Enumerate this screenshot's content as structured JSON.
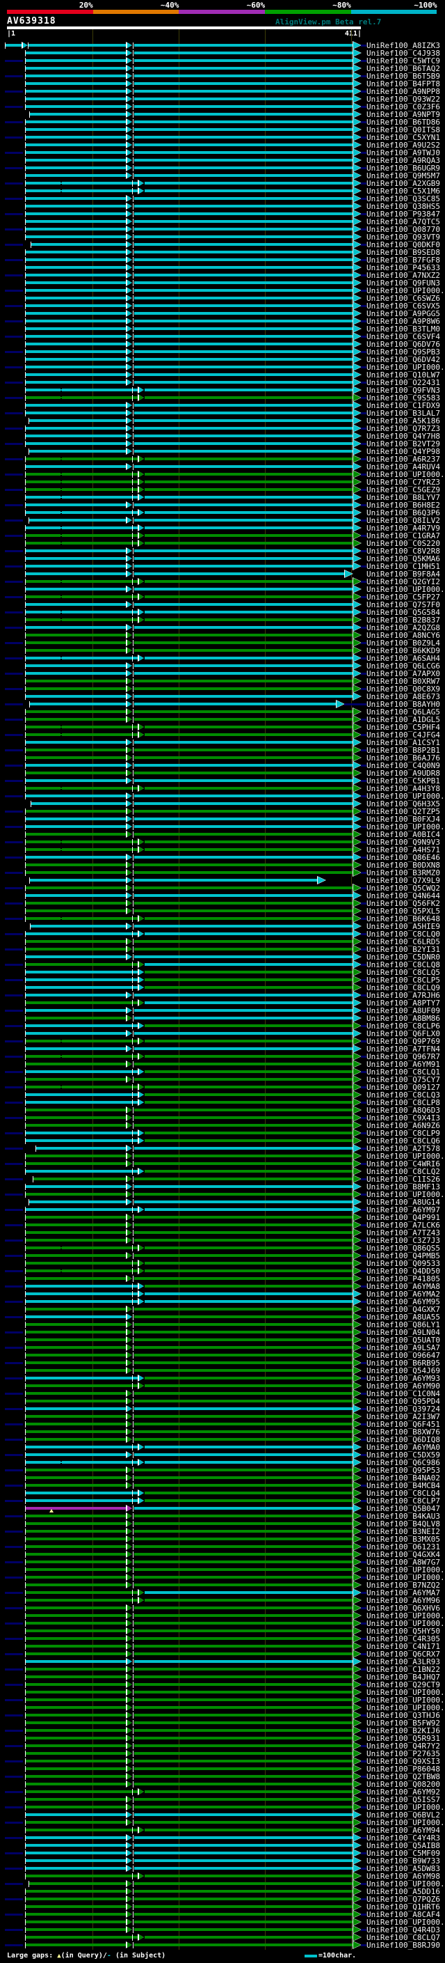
{
  "header": {
    "query_id": "AV639318",
    "app_title": "AlignView.pm Beta rel.7",
    "ruler_left": "|1",
    "ruler_right": "411|",
    "scale": [
      {
        "label": "20%",
        "color": "#e4001c"
      },
      {
        "label": "~40%",
        "color": "#e07800"
      },
      {
        "label": "~60%",
        "color": "#a02cb4"
      },
      {
        "label": "~80%",
        "color": "#00a000"
      },
      {
        "label": "~100%",
        "color": "#00b4c8"
      }
    ]
  },
  "legend": {
    "gaps_label": "Large gaps: ",
    "query_symbol": "▲",
    "in_query": "(in Query)/",
    "subject_symbol": "-",
    "in_subject": " (in Subject)",
    "scale_label": "=100char."
  },
  "colors": {
    "c": "#00c2cc",
    "g": "#008c00",
    "m": "#a428b0",
    "navy": "#000066",
    "grid": "#3c3c08",
    "yellow": "#ffff99",
    "label": "#f0f0f0",
    "black": "#000000",
    "white": "#ffffff"
  },
  "label_prefix": "UniRef100_",
  "rows": [
    {
      "l": "A8IZK3",
      "pre": 1,
      "s": 41
    },
    {
      "l": "C4J938"
    },
    {
      "l": "C5WTC9"
    },
    {
      "l": "B6TAQ2"
    },
    {
      "l": "B6T5B9"
    },
    {
      "l": "B4FPT8"
    },
    {
      "l": "A9NPP8"
    },
    {
      "l": "Q93W22"
    },
    {
      "l": "C0Z3F6"
    },
    {
      "l": "A9NPT9",
      "s": 43
    },
    {
      "l": "B6TD86"
    },
    {
      "l": "Q0ITS8"
    },
    {
      "l": "C5XYN1"
    },
    {
      "l": "A9U2S2"
    },
    {
      "l": "A9TWJ0"
    },
    {
      "l": "A9RQA3"
    },
    {
      "l": "B6UGR9"
    },
    {
      "l": "Q9M5M7"
    },
    {
      "l": "A2XGB9",
      "g": "l",
      "d": 1
    },
    {
      "l": "C5X1M6",
      "g": "l",
      "d": 1
    },
    {
      "l": "Q3SC85"
    },
    {
      "l": "Q38HS5"
    },
    {
      "l": "P93847"
    },
    {
      "l": "A7QTC5"
    },
    {
      "l": "Q08770"
    },
    {
      "l": "Q93VT9"
    },
    {
      "l": "Q0DKF0",
      "s": 45
    },
    {
      "l": "B9SED8"
    },
    {
      "l": "B7FGF8"
    },
    {
      "l": "P45633"
    },
    {
      "l": "A7NXZ2"
    },
    {
      "l": "Q9FUN3"
    },
    {
      "l": "UPI000.."
    },
    {
      "l": "C6SWZ6"
    },
    {
      "l": "C6SVX5"
    },
    {
      "l": "A9PGG5"
    },
    {
      "l": "A9P8W6"
    },
    {
      "l": "B3TLM0"
    },
    {
      "l": "C6SVF4"
    },
    {
      "l": "Q6DV76"
    },
    {
      "l": "Q9SPB3"
    },
    {
      "l": "Q6DV42"
    },
    {
      "l": "UPI000.."
    },
    {
      "l": "Q10LW7"
    },
    {
      "l": "O22431"
    },
    {
      "l": "Q9FVN3",
      "g": "l",
      "d": 1
    },
    {
      "l": "C9S583",
      "h": "g",
      "g": "l",
      "d": 1
    },
    {
      "l": "C1FDX9"
    },
    {
      "l": "B3LAL7"
    },
    {
      "l": "A5K186",
      "s": 42
    },
    {
      "l": "Q7R7Z3"
    },
    {
      "l": "Q4Y7H8"
    },
    {
      "l": "B2VT29"
    },
    {
      "l": "Q4YP98",
      "s": 42
    },
    {
      "l": "A6R237",
      "h": "g",
      "g": "l",
      "d": 1
    },
    {
      "l": "A4RUV4"
    },
    {
      "l": "UPI000..",
      "h": "g",
      "g": "l",
      "d": 1
    },
    {
      "l": "C7YRZ3",
      "h": "g",
      "g": "l",
      "d": 1
    },
    {
      "l": "C5GEZ9",
      "h": "g",
      "g": "l",
      "d": 1
    },
    {
      "l": "B8LYV7",
      "g": "l",
      "d": 1
    },
    {
      "l": "B6H8E2"
    },
    {
      "l": "B6Q3P6",
      "g": "l",
      "d": 1
    },
    {
      "l": "Q8ILV2",
      "s": 42
    },
    {
      "l": "A4R7V9",
      "g": "l",
      "d": 1
    },
    {
      "l": "C1GRA7",
      "h": "g",
      "g": "l",
      "d": 1
    },
    {
      "l": "C0S220",
      "h": "g",
      "g": "l",
      "d": 1
    },
    {
      "l": "C8V2R8"
    },
    {
      "l": "Q5KMA6"
    },
    {
      "l": "C1MH51"
    },
    {
      "l": "B9F8A4",
      "e": 496
    },
    {
      "l": "Q2GYI2",
      "h": "g",
      "g": "l",
      "d": 1
    },
    {
      "l": "UPI000.."
    },
    {
      "l": "C5FP27",
      "h": "g",
      "g": "l",
      "d": 1
    },
    {
      "l": "Q7S7F0"
    },
    {
      "l": "Q5G584",
      "g": "l",
      "d": 1
    },
    {
      "l": "B2B837",
      "h": "g",
      "g": "l",
      "d": 1
    },
    {
      "l": "A2QZG8"
    },
    {
      "l": "A8NCY6",
      "h": "g"
    },
    {
      "l": "B0Z9L4",
      "h": "g"
    },
    {
      "l": "B6KKD9",
      "h": "g"
    },
    {
      "l": "A6SAH4",
      "g": "l",
      "d": 1
    },
    {
      "l": "Q6LCG6"
    },
    {
      "l": "A7APX0"
    },
    {
      "l": "B0XRW7",
      "h": "g"
    },
    {
      "l": "Q0C8X9",
      "h": "g"
    },
    {
      "l": "A8E673"
    },
    {
      "l": "B8AYH0",
      "s": 43,
      "e": 484
    },
    {
      "l": "Q6LAG5",
      "h": "g"
    },
    {
      "l": "A1DGL5",
      "h": "g"
    },
    {
      "l": "C5PHF4",
      "h": "g",
      "g": "l",
      "d": 1
    },
    {
      "l": "C4JFG4",
      "h": "g",
      "g": "l",
      "d": 1
    },
    {
      "l": "A1CSY1"
    },
    {
      "l": "B8P2B1",
      "h": "g"
    },
    {
      "l": "B6AJ76",
      "h": "g"
    },
    {
      "l": "C4Q0N9"
    },
    {
      "l": "A9UDR8",
      "h": "g"
    },
    {
      "l": "C5KPB1"
    },
    {
      "l": "A4H3Y8",
      "h": "g",
      "g": "l",
      "d": 1
    },
    {
      "l": "UPI000.."
    },
    {
      "l": "Q6H3X5",
      "s": 45
    },
    {
      "l": "Q2TZP5",
      "h": "g"
    },
    {
      "l": "B0FXJ4"
    },
    {
      "l": "UPI000.."
    },
    {
      "l": "A0BIC4",
      "h": "g"
    },
    {
      "l": "Q9N9V3",
      "h": "g",
      "g": "l",
      "d": 1
    },
    {
      "l": "A4HS71",
      "h": "g",
      "g": "l",
      "d": 1
    },
    {
      "l": "Q86E46"
    },
    {
      "l": "B0DXN8",
      "h": "g"
    },
    {
      "l": "B3RMZ0",
      "h": "g"
    },
    {
      "l": "Q7X9L9",
      "s": 43,
      "e": 457
    },
    {
      "l": "Q5CWQ2",
      "h": "g"
    },
    {
      "l": "Q4N644"
    },
    {
      "l": "Q56FK2",
      "h": "g"
    },
    {
      "l": "Q5PXL5",
      "h": "g"
    },
    {
      "l": "B6K648",
      "h": "g",
      "g": "l",
      "d": 1
    },
    {
      "l": "A5HIE9",
      "s": 44
    },
    {
      "l": "C8CLQ0",
      "g": "l"
    },
    {
      "l": "C6LRD5",
      "h": "g"
    },
    {
      "l": "B2YI31",
      "h": "g"
    },
    {
      "l": "C5DNR0"
    },
    {
      "l": "C8CLQ8",
      "h": "g",
      "t": "c",
      "g": "l"
    },
    {
      "l": "C8CLQ5",
      "t": "g",
      "g": "l"
    },
    {
      "l": "C8CLP5",
      "t": "g",
      "g": "l"
    },
    {
      "l": "C8CLQ9",
      "t": "g",
      "g": "l"
    },
    {
      "l": "A7RJH6"
    },
    {
      "l": "A8PTY7",
      "h": "g",
      "t": "c",
      "g": "l"
    },
    {
      "l": "A8UF09"
    },
    {
      "l": "A8BM86",
      "h": "g",
      "t": "c"
    },
    {
      "l": "C8CLP6",
      "t": "g",
      "g": "l"
    },
    {
      "l": "Q6FLX0"
    },
    {
      "l": "Q9P769",
      "h": "g",
      "g": "l",
      "d": 1
    },
    {
      "l": "A7TFN4"
    },
    {
      "l": "Q967R7",
      "h": "g",
      "g": "l",
      "d": 1
    },
    {
      "l": "A6YM91",
      "h": "g"
    },
    {
      "l": "C8CLQ1",
      "t": "g",
      "g": "l"
    },
    {
      "l": "Q75CY7",
      "h": "g"
    },
    {
      "l": "Q09127",
      "h": "g",
      "g": "l",
      "d": 1
    },
    {
      "l": "C8CLQ3",
      "t": "g",
      "g": "l"
    },
    {
      "l": "C8CLP8",
      "t": "g",
      "g": "l"
    },
    {
      "l": "A8Q6D3",
      "h": "g"
    },
    {
      "l": "C9X4I3",
      "h": "g"
    },
    {
      "l": "A6N9Z6",
      "h": "g"
    },
    {
      "l": "C8CLP9",
      "t": "g",
      "g": "l"
    },
    {
      "l": "C8CLQ6",
      "t": "g",
      "g": "l"
    },
    {
      "l": "A2T578",
      "s": 52
    },
    {
      "l": "UPI000..",
      "h": "g"
    },
    {
      "l": "C4WRI6",
      "h": "g"
    },
    {
      "l": "C8CLQ2",
      "t": "g",
      "g": "l"
    },
    {
      "l": "C1IS26",
      "h": "g",
      "s": 48
    },
    {
      "l": "B8MF13"
    },
    {
      "l": "UPI000..",
      "h": "g"
    },
    {
      "l": "A8UG14",
      "s": 42
    },
    {
      "l": "A6YM97",
      "g": "l"
    },
    {
      "l": "Q4P991",
      "h": "g"
    },
    {
      "l": "A7LCK6",
      "h": "g"
    },
    {
      "l": "A7TZ43",
      "h": "g"
    },
    {
      "l": "C3Z7J3",
      "h": "g"
    },
    {
      "l": "Q86QS5",
      "h": "g",
      "g": "l",
      "d": 1
    },
    {
      "l": "Q4PMB5",
      "h": "g"
    },
    {
      "l": "Q09533",
      "h": "g",
      "t": "g",
      "g": "l"
    },
    {
      "l": "Q4DD50",
      "h": "g",
      "g": "l",
      "d": 1
    },
    {
      "l": "P41805",
      "h": "g"
    },
    {
      "l": "A6YMA8",
      "t": "g",
      "g": "l"
    },
    {
      "l": "A6YMA2",
      "g": "l"
    },
    {
      "l": "A6YM95",
      "g": "l"
    },
    {
      "l": "Q4GXK7",
      "h": "g"
    },
    {
      "l": "A8UA55",
      "t": "g"
    },
    {
      "l": "Q86LY1",
      "h": "g"
    },
    {
      "l": "A9LN04",
      "h": "g"
    },
    {
      "l": "Q5UAT0",
      "h": "g"
    },
    {
      "l": "A9LSA7",
      "h": "g"
    },
    {
      "l": "O96647",
      "h": "g"
    },
    {
      "l": "B6RB95",
      "h": "g"
    },
    {
      "l": "Q54J69",
      "h": "g"
    },
    {
      "l": "A6YM93",
      "t": "g",
      "g": "l"
    },
    {
      "l": "A6YM90",
      "h": "g",
      "t": "g",
      "g": "l"
    },
    {
      "l": "C1C0N4",
      "h": "g"
    },
    {
      "l": "Q95PD4",
      "h": "g"
    },
    {
      "l": "Q39724"
    },
    {
      "l": "A2I3W7",
      "h": "g"
    },
    {
      "l": "Q6F451",
      "h": "g"
    },
    {
      "l": "B8XW76",
      "h": "g"
    },
    {
      "l": "Q6DIQ8",
      "h": "g"
    },
    {
      "l": "A6YMA0",
      "g": "l"
    },
    {
      "l": "C5DX59"
    },
    {
      "l": "Q6C986",
      "g": "l",
      "d": 1
    },
    {
      "l": "Q95P53",
      "h": "g"
    },
    {
      "l": "B4NA02",
      "h": "g"
    },
    {
      "l": "B4MCB4",
      "h": "g"
    },
    {
      "l": "C8CLQ4",
      "t": "g",
      "g": "l"
    },
    {
      "l": "C8CLP7",
      "t": "g",
      "g": "l"
    },
    {
      "l": "Q5B047",
      "h": "m",
      "t": "c",
      "gm": 1
    },
    {
      "l": "B4KAU3",
      "h": "g"
    },
    {
      "l": "B4QLV8",
      "h": "g"
    },
    {
      "l": "B3NEI2",
      "h": "g"
    },
    {
      "l": "B3MX05",
      "h": "g"
    },
    {
      "l": "O61231",
      "h": "g"
    },
    {
      "l": "Q4GXK4",
      "h": "g",
      "t": "g"
    },
    {
      "l": "A8W7G7",
      "h": "g"
    },
    {
      "l": "UPI000..",
      "h": "g"
    },
    {
      "l": "UPI000..",
      "h": "g"
    },
    {
      "l": "B7NZQ2",
      "h": "g"
    },
    {
      "l": "A6YMA7",
      "h": "g",
      "t": "c",
      "g": "l"
    },
    {
      "l": "A6YM96",
      "h": "g",
      "t": "g",
      "g": "l"
    },
    {
      "l": "Q6XHV6",
      "h": "g"
    },
    {
      "l": "UPI000..",
      "h": "g"
    },
    {
      "l": "UPI000..",
      "h": "g"
    },
    {
      "l": "Q5HY50",
      "h": "g"
    },
    {
      "l": "C4R305",
      "h": "g"
    },
    {
      "l": "C4N171",
      "h": "g"
    },
    {
      "l": "Q6CRX7",
      "h": "g"
    },
    {
      "l": "A3LR93"
    },
    {
      "l": "C1BN22",
      "h": "g"
    },
    {
      "l": "B4JHQ7",
      "h": "g"
    },
    {
      "l": "Q29CT9",
      "h": "g"
    },
    {
      "l": "UPI000..",
      "h": "g"
    },
    {
      "l": "UPI000..",
      "h": "g"
    },
    {
      "l": "UPI000..",
      "h": "g"
    },
    {
      "l": "Q3THJ6",
      "h": "g"
    },
    {
      "l": "B5FW92",
      "h": "g"
    },
    {
      "l": "B2KIJ6",
      "h": "g"
    },
    {
      "l": "Q5R931",
      "h": "g"
    },
    {
      "l": "Q4R7Y2",
      "h": "g"
    },
    {
      "l": "P27635",
      "h": "g"
    },
    {
      "l": "Q9XSI3",
      "h": "g"
    },
    {
      "l": "P86048",
      "h": "g"
    },
    {
      "l": "Q2TBW8",
      "h": "g"
    },
    {
      "l": "Q08200",
      "h": "g"
    },
    {
      "l": "A6YM92",
      "h": "g",
      "t": "g",
      "g": "l"
    },
    {
      "l": "Q5ISS7",
      "h": "g"
    },
    {
      "l": "UPI000..",
      "h": "g"
    },
    {
      "l": "Q6BVL2"
    },
    {
      "l": "UPI000..",
      "h": "g"
    },
    {
      "l": "A6YM94",
      "h": "g",
      "t": "g",
      "g": "l"
    },
    {
      "l": "C4Y4R3"
    },
    {
      "l": "Q5AIB8"
    },
    {
      "l": "C5MF09"
    },
    {
      "l": "B9W733"
    },
    {
      "l": "A5DW83"
    },
    {
      "l": "A6YM98",
      "h": "g",
      "t": "g",
      "g": "l"
    },
    {
      "l": "UPI000..",
      "h": "g",
      "s": 42
    },
    {
      "l": "A5DD16",
      "h": "g"
    },
    {
      "l": "Q7PQZ6",
      "h": "g"
    },
    {
      "l": "Q1HRT6",
      "h": "g"
    },
    {
      "l": "A8CAF4",
      "h": "g"
    },
    {
      "l": "UPI000..",
      "h": "g"
    },
    {
      "l": "Q4R4D3",
      "h": "g"
    },
    {
      "l": "C8CLQ7",
      "h": "g",
      "t": "g",
      "g": "l"
    },
    {
      "l": "B8RJ90",
      "h": "g"
    }
  ]
}
